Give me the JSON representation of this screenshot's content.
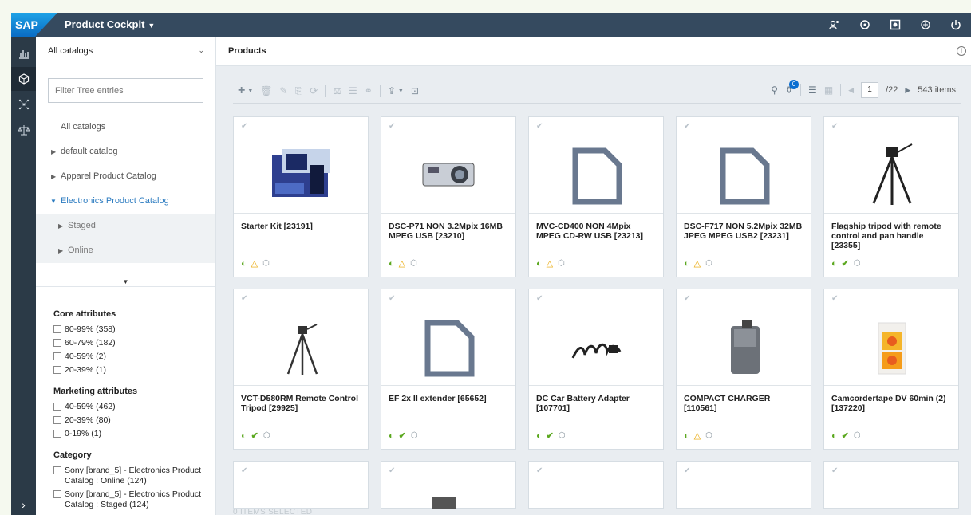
{
  "shell": {
    "title": "Product Cockpit",
    "logo_text": "SAP",
    "icons": [
      "user-group-icon",
      "sync-icon",
      "notification-icon",
      "settings-icon",
      "power-icon"
    ]
  },
  "rail": {
    "icons": [
      "analytics-icon",
      "product-cube-icon",
      "network-icon",
      "balance-icon"
    ]
  },
  "sidebar": {
    "catalog_select": "All catalogs",
    "filter_placeholder": "Filter Tree entries",
    "tree": [
      {
        "label": "All catalogs"
      },
      {
        "label": "default catalog"
      },
      {
        "label": "Apparel Product Catalog"
      },
      {
        "label": "Electronics Product Catalog"
      },
      {
        "label": "Staged"
      },
      {
        "label": "Online"
      }
    ],
    "facets": [
      {
        "title": "Core attributes",
        "options": [
          "80-99% (358)",
          "60-79% (182)",
          "40-59% (2)",
          "20-39% (1)"
        ]
      },
      {
        "title": "Marketing attributes",
        "options": [
          "40-59% (462)",
          "20-39% (80)",
          "0-19% (1)"
        ]
      },
      {
        "title": "Category",
        "options": [
          "Sony [brand_5] - Electronics Product Catalog : Online (124)",
          "Sony [brand_5] - Electronics Product Catalog : Staged (124)"
        ]
      }
    ]
  },
  "main": {
    "title": "Products",
    "toolbar": {
      "filter_badge": "0",
      "page": "1",
      "page_total": "/22",
      "item_count": "543 items"
    },
    "products": [
      {
        "name": "Starter Kit [23191]",
        "status": [
          "half",
          "warn",
          "cube"
        ],
        "image": "starter-kit"
      },
      {
        "name": "DSC-P71 NON 3.2Mpix 16MB MPEG USB [23210]",
        "status": [
          "half",
          "warn",
          "cube"
        ],
        "image": "camera"
      },
      {
        "name": "MVC-CD400 NON 4Mpix MPEG CD-RW USB [23213]",
        "status": [
          "half",
          "warn",
          "cube"
        ],
        "image": "placeholder"
      },
      {
        "name": "DSC-F717 NON 5.2Mpix 32MB JPEG MPEG USB2 [23231]",
        "status": [
          "half",
          "warn",
          "cube"
        ],
        "image": "placeholder"
      },
      {
        "name": "Flagship tripod with remote control and pan handle [23355]",
        "status": [
          "half",
          "ok",
          "cube"
        ],
        "image": "tripod-tall"
      },
      {
        "name": "VCT-D580RM Remote Control Tripod [29925]",
        "status": [
          "half",
          "ok",
          "cube"
        ],
        "image": "tripod-small"
      },
      {
        "name": "EF 2x II extender [65652]",
        "status": [
          "half",
          "ok",
          "cube"
        ],
        "image": "placeholder"
      },
      {
        "name": "DC Car Battery Adapter [107701]",
        "status": [
          "half",
          "ok",
          "cube"
        ],
        "image": "cable"
      },
      {
        "name": "COMPACT CHARGER [110561]",
        "status": [
          "half",
          "warn",
          "cube"
        ],
        "image": "charger"
      },
      {
        "name": "Camcordertape DV 60min (2) [137220]",
        "status": [
          "half",
          "ok",
          "cube"
        ],
        "image": "tape"
      }
    ],
    "selected_text": "0 ITEMS SELECTED"
  }
}
